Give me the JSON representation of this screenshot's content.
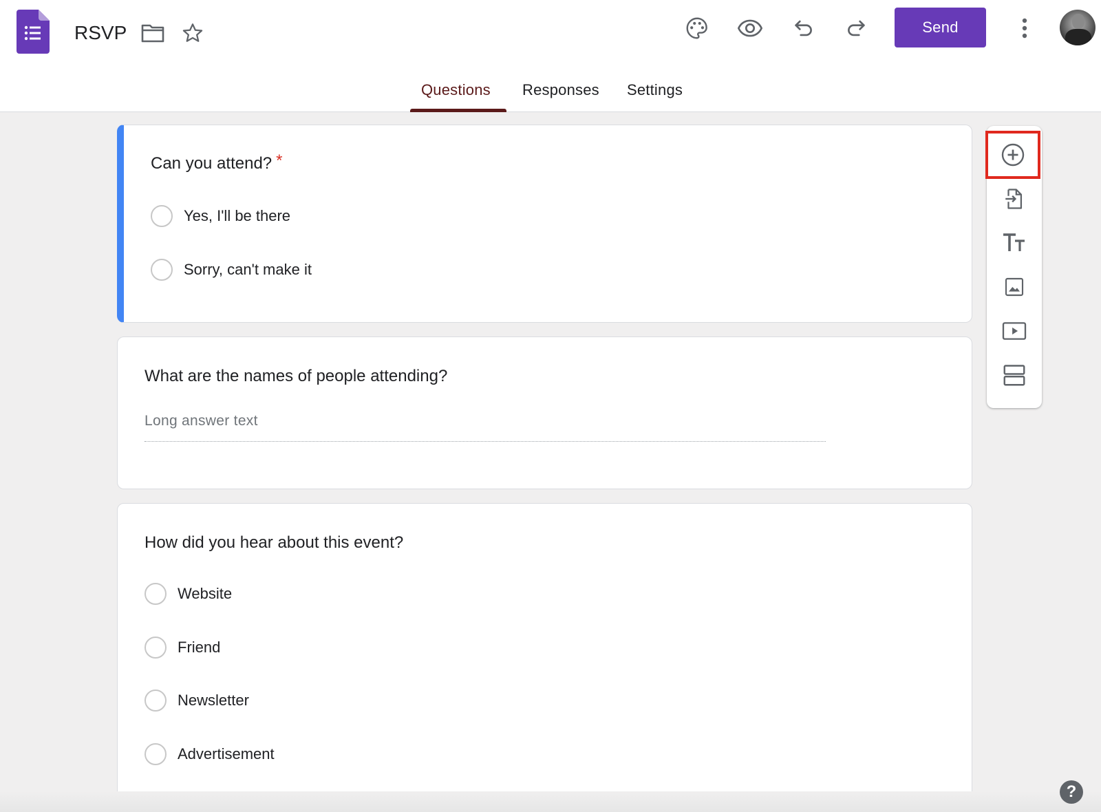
{
  "app": {
    "title": "RSVP",
    "brand_color": "#673ab7",
    "accent_color": "#4285f4",
    "required_color": "#d93025"
  },
  "header": {
    "send_label": "Send",
    "icons": [
      "forms-logo-icon",
      "folder-icon",
      "star-icon",
      "palette-icon",
      "preview-eye-icon",
      "undo-icon",
      "redo-icon",
      "more-vert-icon",
      "avatar"
    ]
  },
  "tabs": [
    {
      "label": "Questions",
      "active": true
    },
    {
      "label": "Responses",
      "active": false
    },
    {
      "label": "Settings",
      "active": false
    }
  ],
  "questions": [
    {
      "title": "Can you attend?",
      "required_mark": "*",
      "type": "multiple_choice",
      "options": [
        "Yes,  I'll be there",
        "Sorry, can't make it"
      ]
    },
    {
      "title": "What are the names of people attending?",
      "type": "paragraph",
      "placeholder": "Long answer text"
    },
    {
      "title": "How did you hear about this event?",
      "type": "multiple_choice",
      "options": [
        "Website",
        "Friend",
        "Newsletter",
        "Advertisement"
      ]
    }
  ],
  "toolbar": {
    "items": [
      "add-question-icon",
      "import-questions-icon",
      "add-title-icon",
      "add-image-icon",
      "add-video-icon",
      "add-section-icon"
    ],
    "highlighted": "add-question-icon"
  },
  "help_label": "?"
}
